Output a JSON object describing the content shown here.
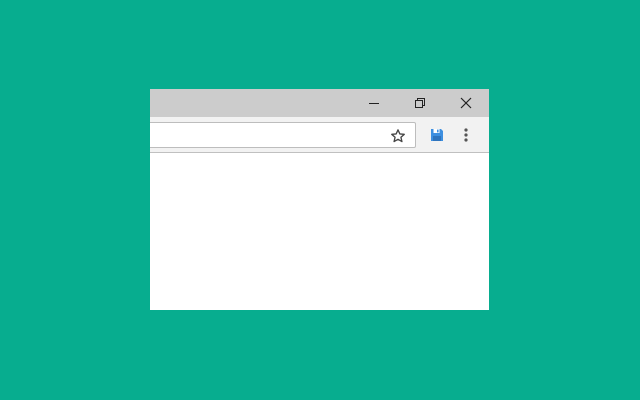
{
  "window": {
    "controls": {
      "minimize_icon": "minimize-icon",
      "restore_icon": "restore-icon",
      "close_icon": "close-icon"
    }
  },
  "toolbar": {
    "address_bar": {
      "value": "",
      "placeholder": ""
    },
    "bookmark_icon": "star-icon",
    "extension_icon": "floppy-disk-icon",
    "menu_icon": "vertical-dots-icon"
  },
  "colors": {
    "desktop_background": "#07ad8f",
    "titlebar": "#cccccc",
    "toolbar": "#f2f2f2",
    "extension_icon_accent": "#3d8fe0"
  }
}
